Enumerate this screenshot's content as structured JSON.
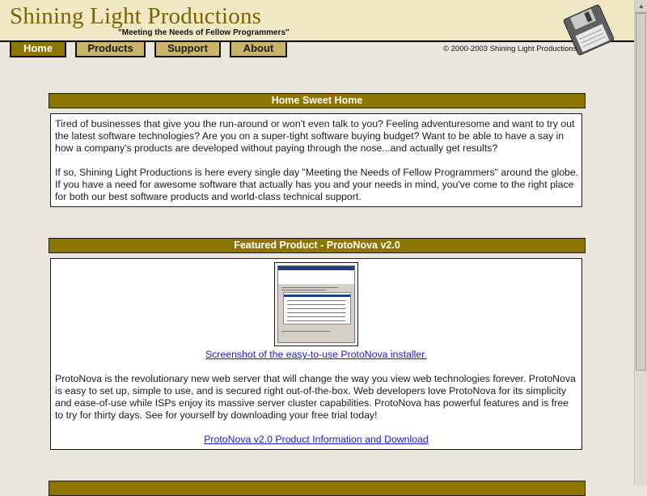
{
  "site": {
    "title": "Shining Light Productions",
    "tagline": "\"Meeting the Needs of Fellow Programmers\"",
    "logo_icon": "floppy-disk-icon",
    "copyright": "© 2000-2003 Shining Light Productions"
  },
  "nav": {
    "items": [
      {
        "label": "Home"
      },
      {
        "label": "Products"
      },
      {
        "label": "Support"
      },
      {
        "label": "About"
      }
    ]
  },
  "sections": {
    "home": {
      "title": "Home Sweet Home",
      "para1": "Tired of businesses that give you the run-around or won't even talk to you? Feeling adventuresome and want to try out the latest software technologies? Are you on a super-tight software buying budget? Want to be able to have a say in how a company's products are developed without paying through the nose...and actually get results?",
      "para2": "If so, Shining Light Productions is here every single day \"Meeting the Needs of Fellow Programmers\" around the globe. If you have a need for awesome software that actually has you and your needs in mind, you've come to the right place for both our best software products and world-class technical support."
    },
    "featured": {
      "title": "Featured Product - ProtoNova v2.0",
      "screenshot_link": "Screenshot of the easy-to-use ProtoNova installer.",
      "description": "ProtoNova is the revolutionary new web server that will change the way you view web technologies forever. ProtoNova is easy to set up, simple to use, and is secured right out-of-the-box. Web developers love ProtoNova for its simplicity and ease-of-use while ISPs enjoy its massive server cluster capabilities. ProtoNova has powerful features and is free to try for thirty days. See for yourself by downloading your free trial today!",
      "download_link": "ProtoNova v2.0 Product Information and Download"
    }
  },
  "colors": {
    "header_bg": "#f0e8c4",
    "accent": "#8e7400",
    "nav_bg": "#c9b46a",
    "page_bg": "#ebe7dd",
    "link": "#1a1ad0"
  }
}
